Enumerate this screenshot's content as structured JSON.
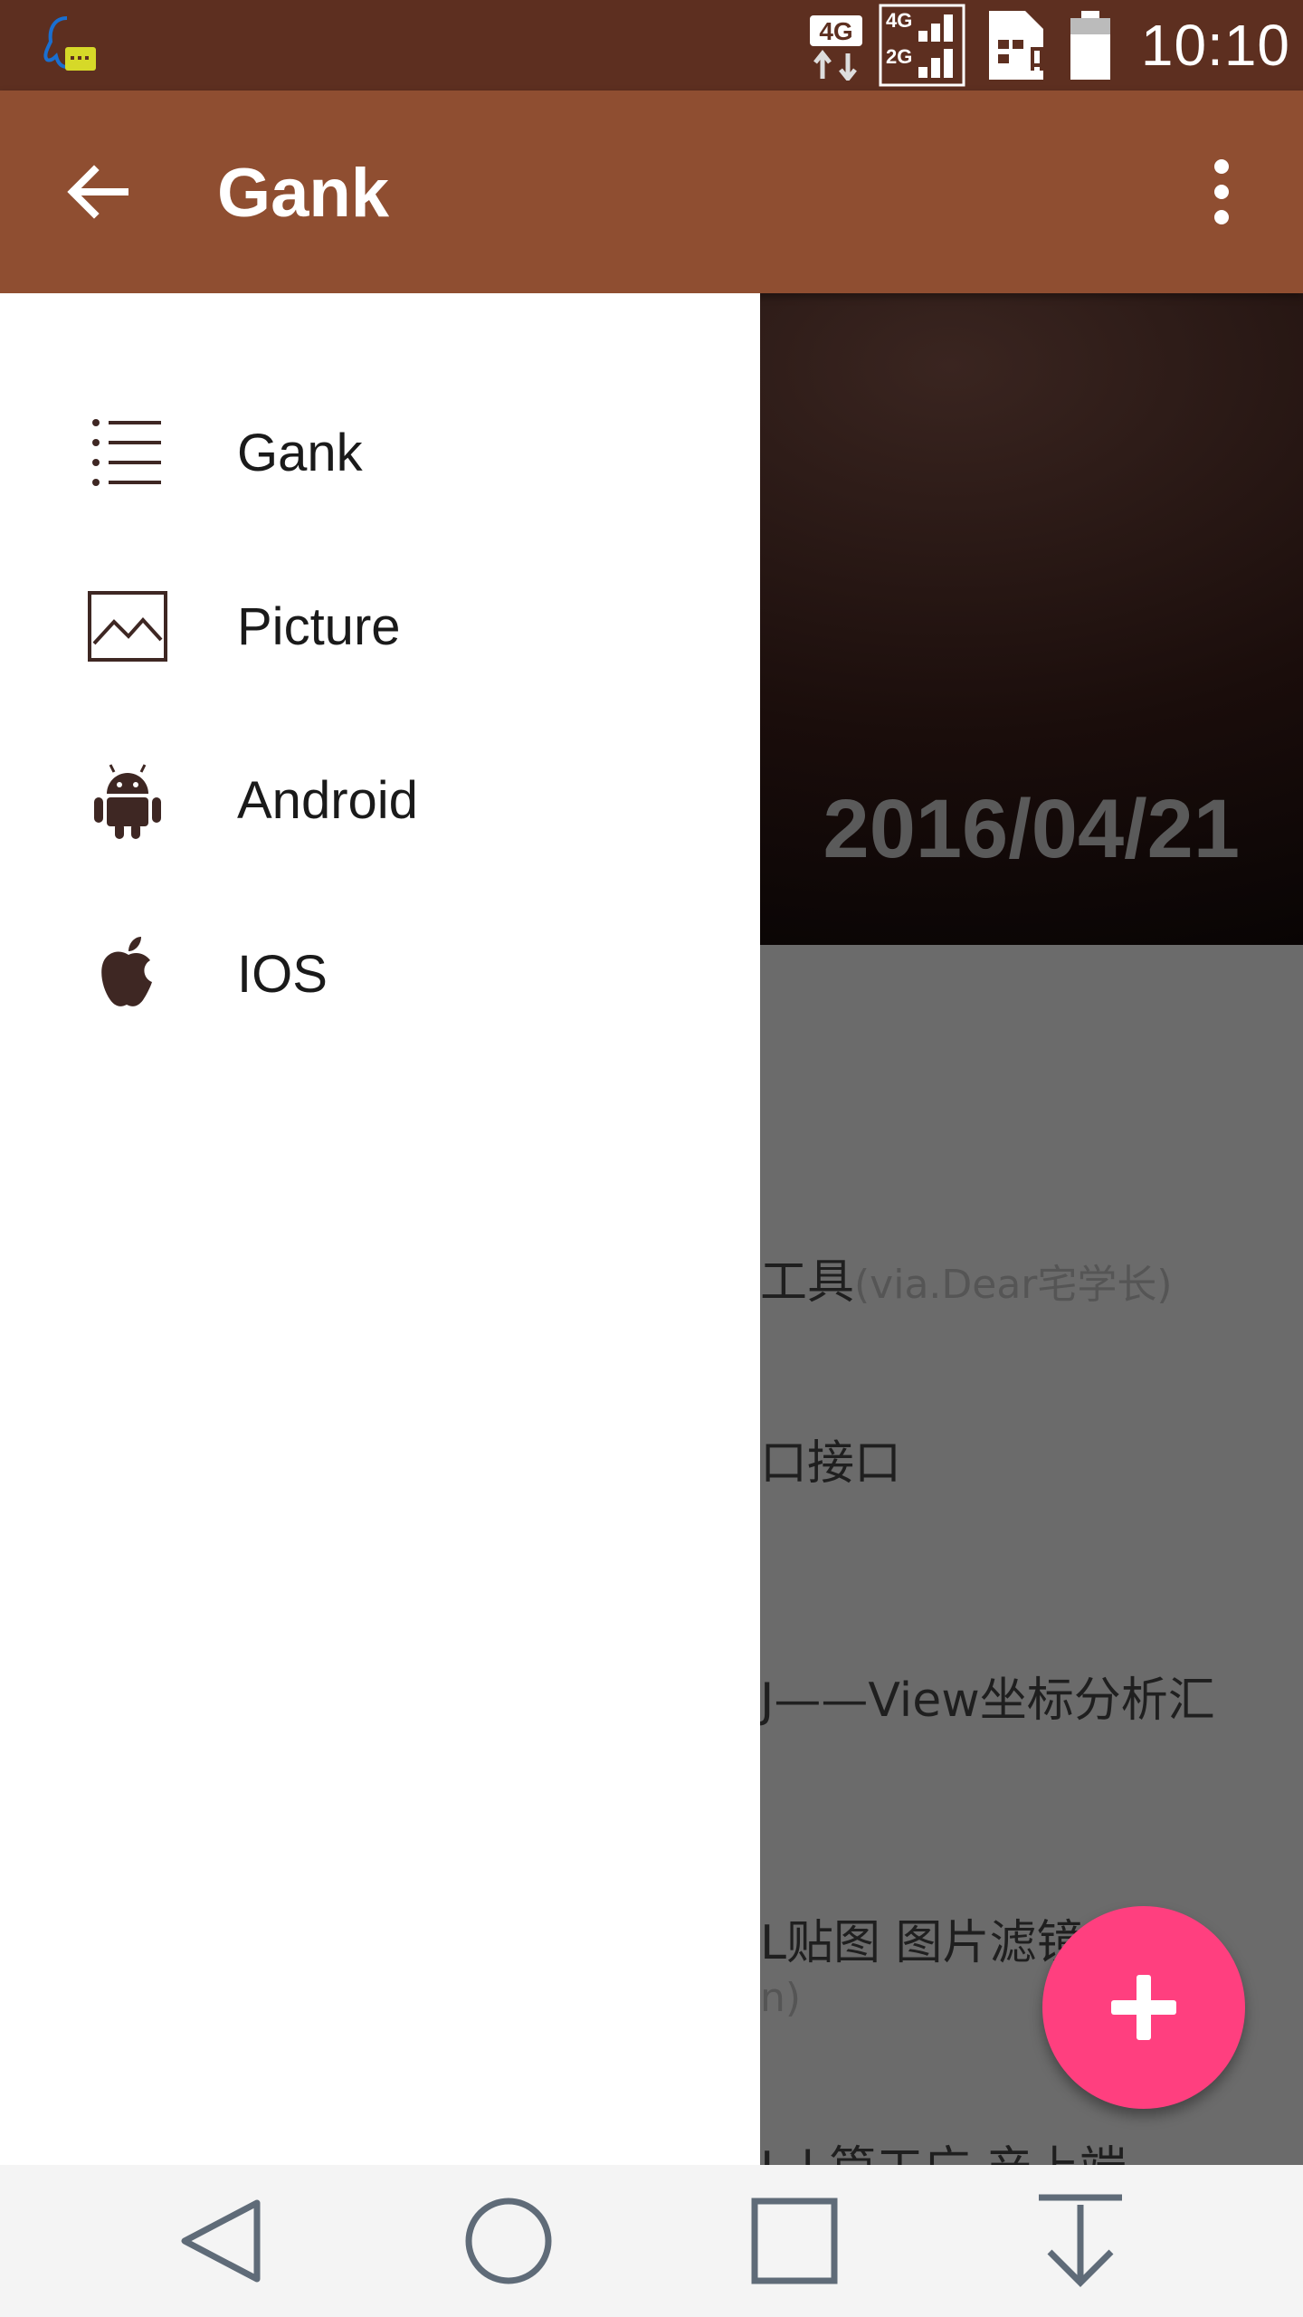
{
  "status_bar": {
    "time": "10:10",
    "icons": [
      "qq-notification-icon",
      "network-4g-icon",
      "signal-4g-2g-icon",
      "sim-alert-icon",
      "battery-icon"
    ]
  },
  "app_bar": {
    "title": "Gank",
    "back_icon": "arrow-left-icon",
    "menu_icon": "more-vert-icon"
  },
  "drawer": {
    "items": [
      {
        "label": "Gank",
        "icon": "list-icon"
      },
      {
        "label": "Picture",
        "icon": "image-icon"
      },
      {
        "label": "Android",
        "icon": "android-icon"
      },
      {
        "label": "IOS",
        "icon": "apple-icon"
      }
    ]
  },
  "content": {
    "date": "2016/04/21",
    "lines": [
      {
        "text": "工具",
        "sub": "(via.Dear宅学长)"
      },
      {
        "text": "口接口",
        "sub": ""
      },
      {
        "text": "J——View坐标分析汇",
        "sub": ""
      },
      {
        "text": "L贴图 图片滤镜",
        "sub": "n)"
      },
      {
        "text": "L    l 篇工广 产上端",
        "sub": ""
      }
    ]
  },
  "fab": {
    "icon": "plus-icon"
  },
  "nav_bar": {
    "buttons": [
      "back-triangle-icon",
      "home-circle-icon",
      "recents-square-icon",
      "notifications-pull-icon"
    ]
  },
  "colors": {
    "status_bar": "#5d2f20",
    "app_bar": "#8f4e31",
    "fab": "#ff3f7f",
    "drawer_icon": "#3e2723"
  }
}
